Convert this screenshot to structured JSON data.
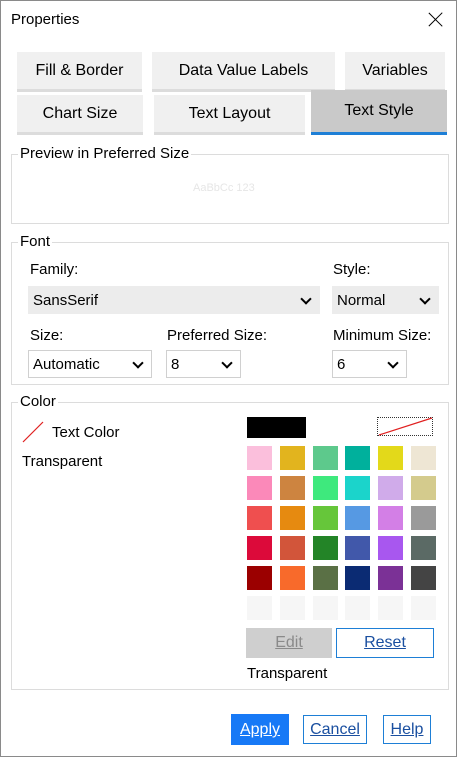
{
  "window": {
    "title": "Properties"
  },
  "tabs": {
    "row1": [
      {
        "label": "Fill & Border"
      },
      {
        "label": "Data Value Labels"
      },
      {
        "label": "Variables"
      }
    ],
    "row2": [
      {
        "label": "Chart Size"
      },
      {
        "label": "Text Layout"
      },
      {
        "label": "Text Style",
        "active": true
      }
    ]
  },
  "preview": {
    "title": "Preview in Preferred Size",
    "sample": "AaBbCc 123"
  },
  "font": {
    "title": "Font",
    "family_label": "Family:",
    "family_value": "SansSerif",
    "style_label": "Style:",
    "style_value": "Normal",
    "size_label": "Size:",
    "size_value": "Automatic",
    "preferred_label": "Preferred Size:",
    "preferred_value": "8",
    "minimum_label": "Minimum Size:",
    "minimum_value": "6"
  },
  "color": {
    "title": "Color",
    "text_color_label": "Text Color",
    "current_value": "Transparent",
    "selected_label": "Transparent",
    "swatches": [
      [
        "#fbbfdc",
        "#e2b41e",
        "#5dc98c",
        "#00b09c",
        "#e3d91a",
        "#eee6d4"
      ],
      [
        "#fb89b9",
        "#cd8440",
        "#3ee97d",
        "#1bd4cb",
        "#d0abea",
        "#d4cb8d"
      ],
      [
        "#ef4f4f",
        "#e68a10",
        "#66c63a",
        "#5699e3",
        "#d37fe6",
        "#9a9a9a"
      ],
      [
        "#dc0a3a",
        "#d2553a",
        "#238427",
        "#4158aa",
        "#a857ef",
        "#5b6a65"
      ],
      [
        "#9b0000",
        "#f86a2b",
        "#5a7045",
        "#0b2b73",
        "#7b3196",
        "#444444"
      ],
      [
        "#f6f6f6",
        "#f6f6f6",
        "#f6f6f6",
        "#f6f6f6",
        "#f6f6f6",
        "#f6f6f6"
      ]
    ],
    "edit_label": "Edit",
    "reset_label": "Reset"
  },
  "buttons": {
    "apply": "Apply",
    "cancel": "Cancel",
    "help": "Help"
  },
  "colors": {
    "accent": "#1e7fd6",
    "apply_bg": "#1779f6"
  }
}
